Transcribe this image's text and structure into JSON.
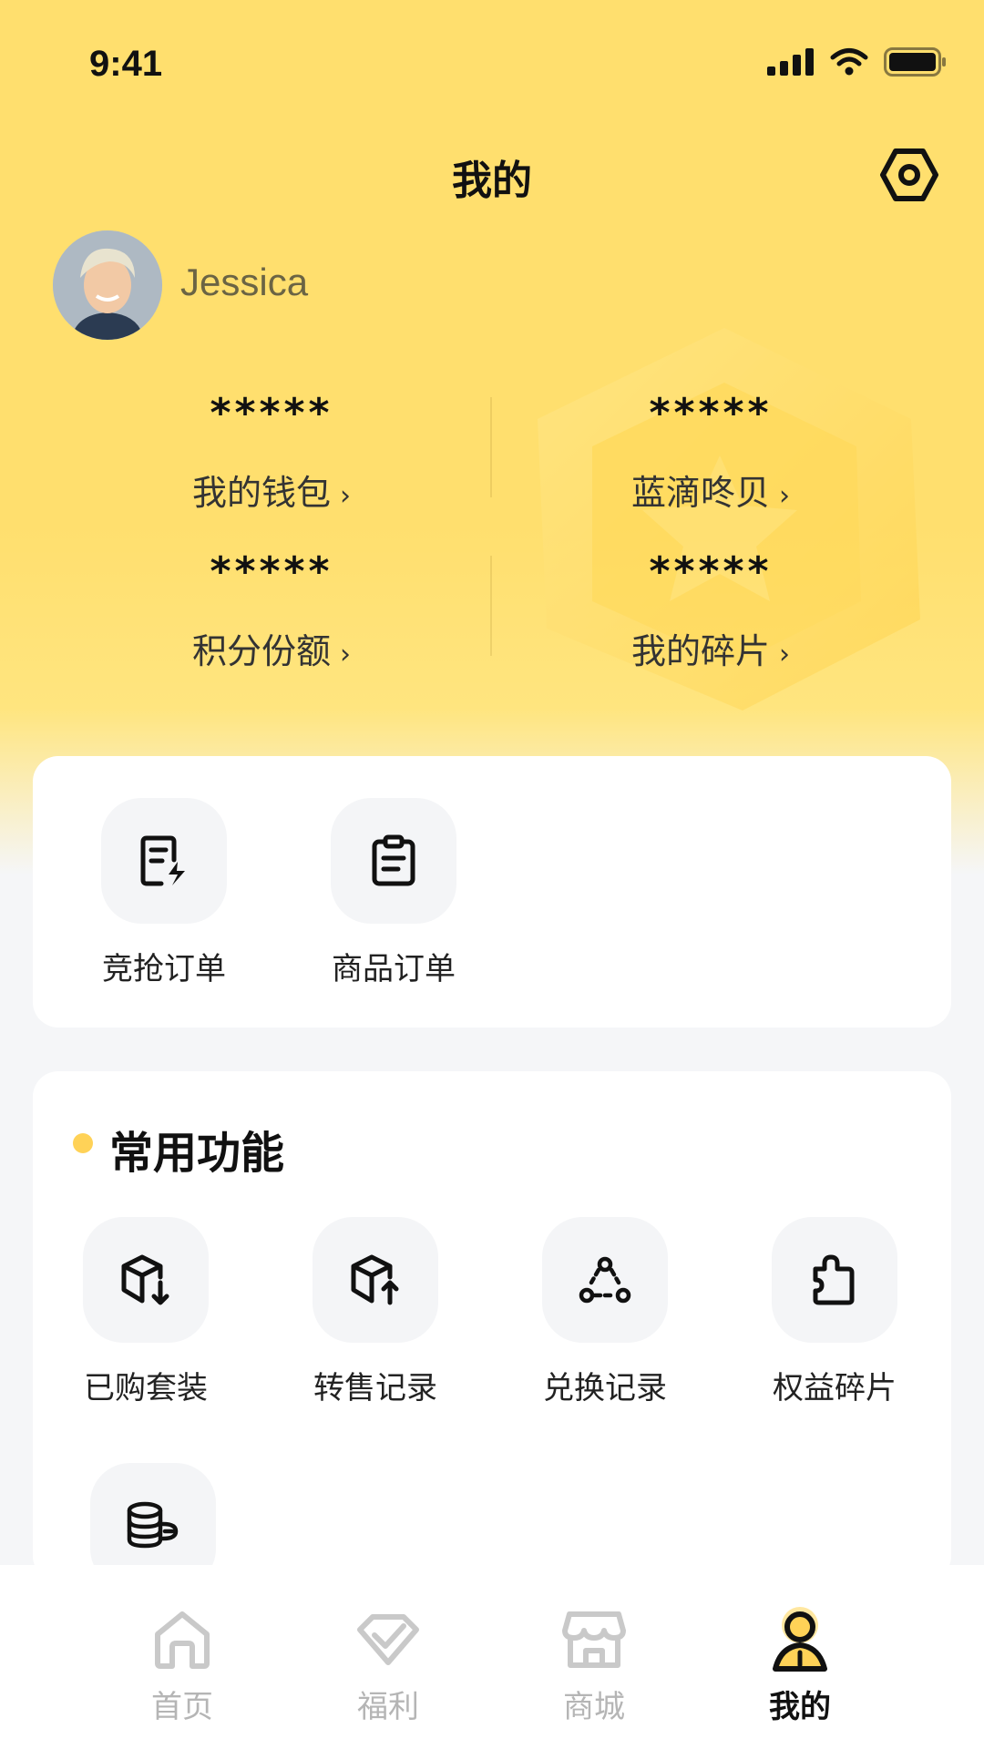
{
  "status_bar": {
    "time": "9:41"
  },
  "header": {
    "title": "我的"
  },
  "profile": {
    "name": "Jessica"
  },
  "assets": [
    {
      "value": "*****",
      "label": "我的钱包"
    },
    {
      "value": "*****",
      "label": "蓝滴咚贝"
    },
    {
      "value": "*****",
      "label": "积分份额"
    },
    {
      "value": "*****",
      "label": "我的碎片"
    }
  ],
  "orders": [
    {
      "label": "竞抢订单",
      "icon": "flash-order-icon"
    },
    {
      "label": "商品订单",
      "icon": "clipboard-icon"
    }
  ],
  "common_functions": {
    "title": "常用功能",
    "items": [
      {
        "label": "已购套装",
        "icon": "box-down-icon"
      },
      {
        "label": "转售记录",
        "icon": "box-up-icon"
      },
      {
        "label": "兑换记录",
        "icon": "exchange-icon"
      },
      {
        "label": "权益碎片",
        "icon": "puzzle-icon"
      },
      {
        "label": "",
        "icon": "coins-icon"
      }
    ]
  },
  "tabbar": [
    {
      "label": "首页",
      "icon": "home-icon"
    },
    {
      "label": "福利",
      "icon": "welfare-icon"
    },
    {
      "label": "商城",
      "icon": "store-icon"
    },
    {
      "label": "我的",
      "icon": "profile-icon",
      "active": true
    }
  ],
  "colors": {
    "accent": "#ffdf6e",
    "dot": "#ffd257",
    "inactive": "#b5b5b5"
  }
}
